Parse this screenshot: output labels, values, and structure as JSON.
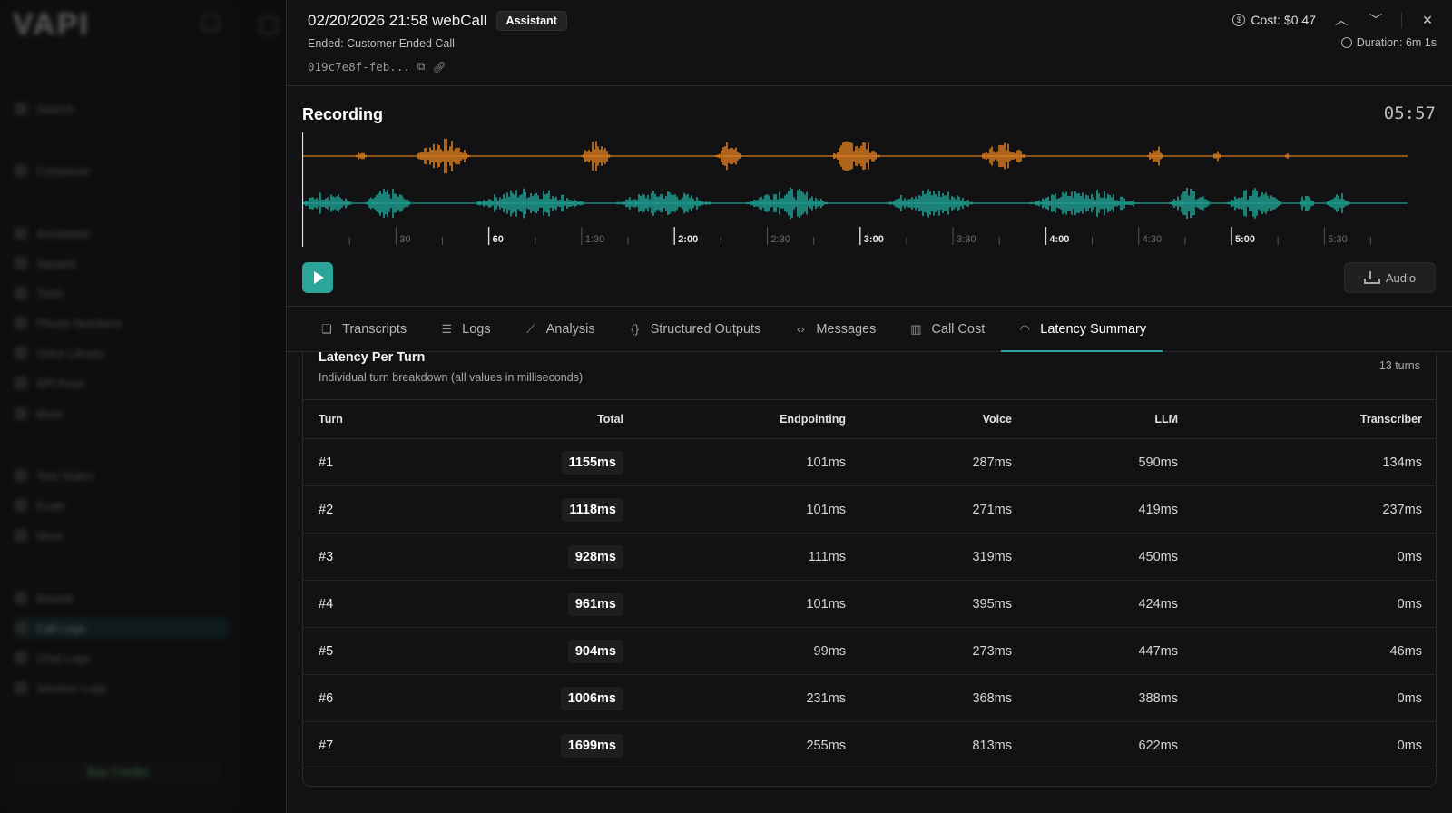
{
  "background_app": {
    "logo": "VAPI",
    "sidebar_items": [
      "Search",
      "Composer",
      "Assistants",
      "Squads",
      "Tools",
      "Phone Numbers",
      "Voice Library",
      "API Keys",
      "More",
      "Test Suites",
      "Evals",
      "More",
      "Boards",
      "Call Logs",
      "Chat Logs",
      "Session Logs"
    ],
    "buy_credits": "Buy Credits"
  },
  "header": {
    "title": "02/20/2026 21:58 webCall",
    "badge": "Assistant",
    "ended": "Ended: Customer Ended Call",
    "call_id": "019c7e8f-feb...",
    "cost": "Cost: $0.47",
    "duration": "Duration: 6m 1s"
  },
  "recording": {
    "title": "Recording",
    "time": "05:57",
    "assistant_color": "#d67a1e",
    "user_color": "#1f9e91",
    "timeline_labels": [
      "30",
      "60",
      "1:30",
      "2:00",
      "2:30",
      "3:00",
      "3:30",
      "4:00",
      "4:30",
      "5:00",
      "5:30"
    ],
    "major_labels": [
      "60",
      "2:00",
      "3:00",
      "4:00",
      "5:00"
    ],
    "audio_button": "Audio"
  },
  "tabs": [
    {
      "label": "Transcripts",
      "icon": "chat-bubbles-icon",
      "glyph": "❏"
    },
    {
      "label": "Logs",
      "icon": "list-icon",
      "glyph": "☰"
    },
    {
      "label": "Analysis",
      "icon": "line-chart-icon",
      "glyph": "⟋"
    },
    {
      "label": "Structured Outputs",
      "icon": "braces-icon",
      "glyph": "{}"
    },
    {
      "label": "Messages",
      "icon": "code-icon",
      "glyph": "‹›"
    },
    {
      "label": "Call Cost",
      "icon": "bar-chart-icon",
      "glyph": "▥"
    },
    {
      "label": "Latency Summary",
      "icon": "gauge-icon",
      "glyph": "◠",
      "active": true
    }
  ],
  "latency": {
    "title": "Latency Per Turn",
    "subtitle": "Individual turn breakdown (all values in milliseconds)",
    "turn_count": "13 turns",
    "columns": [
      "Turn",
      "Total",
      "Endpointing",
      "Voice",
      "LLM",
      "Transcriber"
    ],
    "rows": [
      [
        "#1",
        "1155ms",
        "101ms",
        "287ms",
        "590ms",
        "134ms"
      ],
      [
        "#2",
        "1118ms",
        "101ms",
        "271ms",
        "419ms",
        "237ms"
      ],
      [
        "#3",
        "928ms",
        "111ms",
        "319ms",
        "450ms",
        "0ms"
      ],
      [
        "#4",
        "961ms",
        "101ms",
        "395ms",
        "424ms",
        "0ms"
      ],
      [
        "#5",
        "904ms",
        "99ms",
        "273ms",
        "447ms",
        "46ms"
      ],
      [
        "#6",
        "1006ms",
        "231ms",
        "368ms",
        "388ms",
        "0ms"
      ],
      [
        "#7",
        "1699ms",
        "255ms",
        "813ms",
        "622ms",
        "0ms"
      ]
    ]
  }
}
